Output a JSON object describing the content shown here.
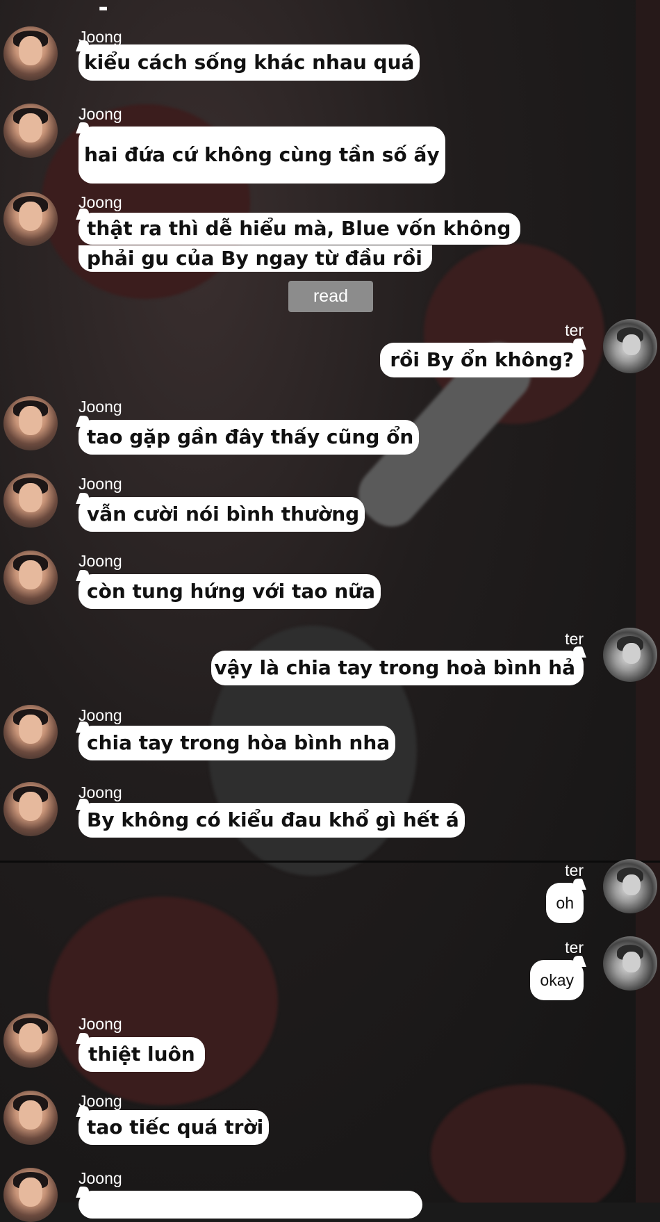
{
  "participants": {
    "joong": "Joong",
    "ter": "ter"
  },
  "read_label": "read",
  "messages": [
    {
      "sender": "Joong",
      "text": "kiểu cách sống khác nhau quá"
    },
    {
      "sender": "Joong",
      "text": "hai đứa cứ không cùng tần số ấy"
    },
    {
      "sender": "Joong",
      "text_line1": "thật ra thì dễ hiểu mà, Blue vốn không",
      "text_line2": "phải gu của By ngay từ đầu rồi"
    },
    {
      "sender": "ter",
      "text": "rồi By ổn không?"
    },
    {
      "sender": "Joong",
      "text": "tao gặp gần đây thấy cũng ổn"
    },
    {
      "sender": "Joong",
      "text": "vẫn cười nói bình thường"
    },
    {
      "sender": "Joong",
      "text": "còn tung hứng với tao nữa"
    },
    {
      "sender": "ter",
      "text": "vậy là chia tay trong hoà bình hả"
    },
    {
      "sender": "Joong",
      "text": "chia tay trong hòa bình nha"
    },
    {
      "sender": "Joong",
      "text": "By không có kiểu đau khổ gì hết á"
    },
    {
      "sender": "ter",
      "text": "oh"
    },
    {
      "sender": "ter",
      "text": "okay"
    },
    {
      "sender": "Joong",
      "text": "thiệt luôn"
    },
    {
      "sender": "Joong",
      "text": "tao tiếc quá trời"
    },
    {
      "sender": "Joong",
      "text": ""
    }
  ],
  "colors": {
    "bubble": "#ffffff",
    "text": "#111111",
    "name": "#ffffff",
    "read_badge": "#8c8c8c"
  }
}
